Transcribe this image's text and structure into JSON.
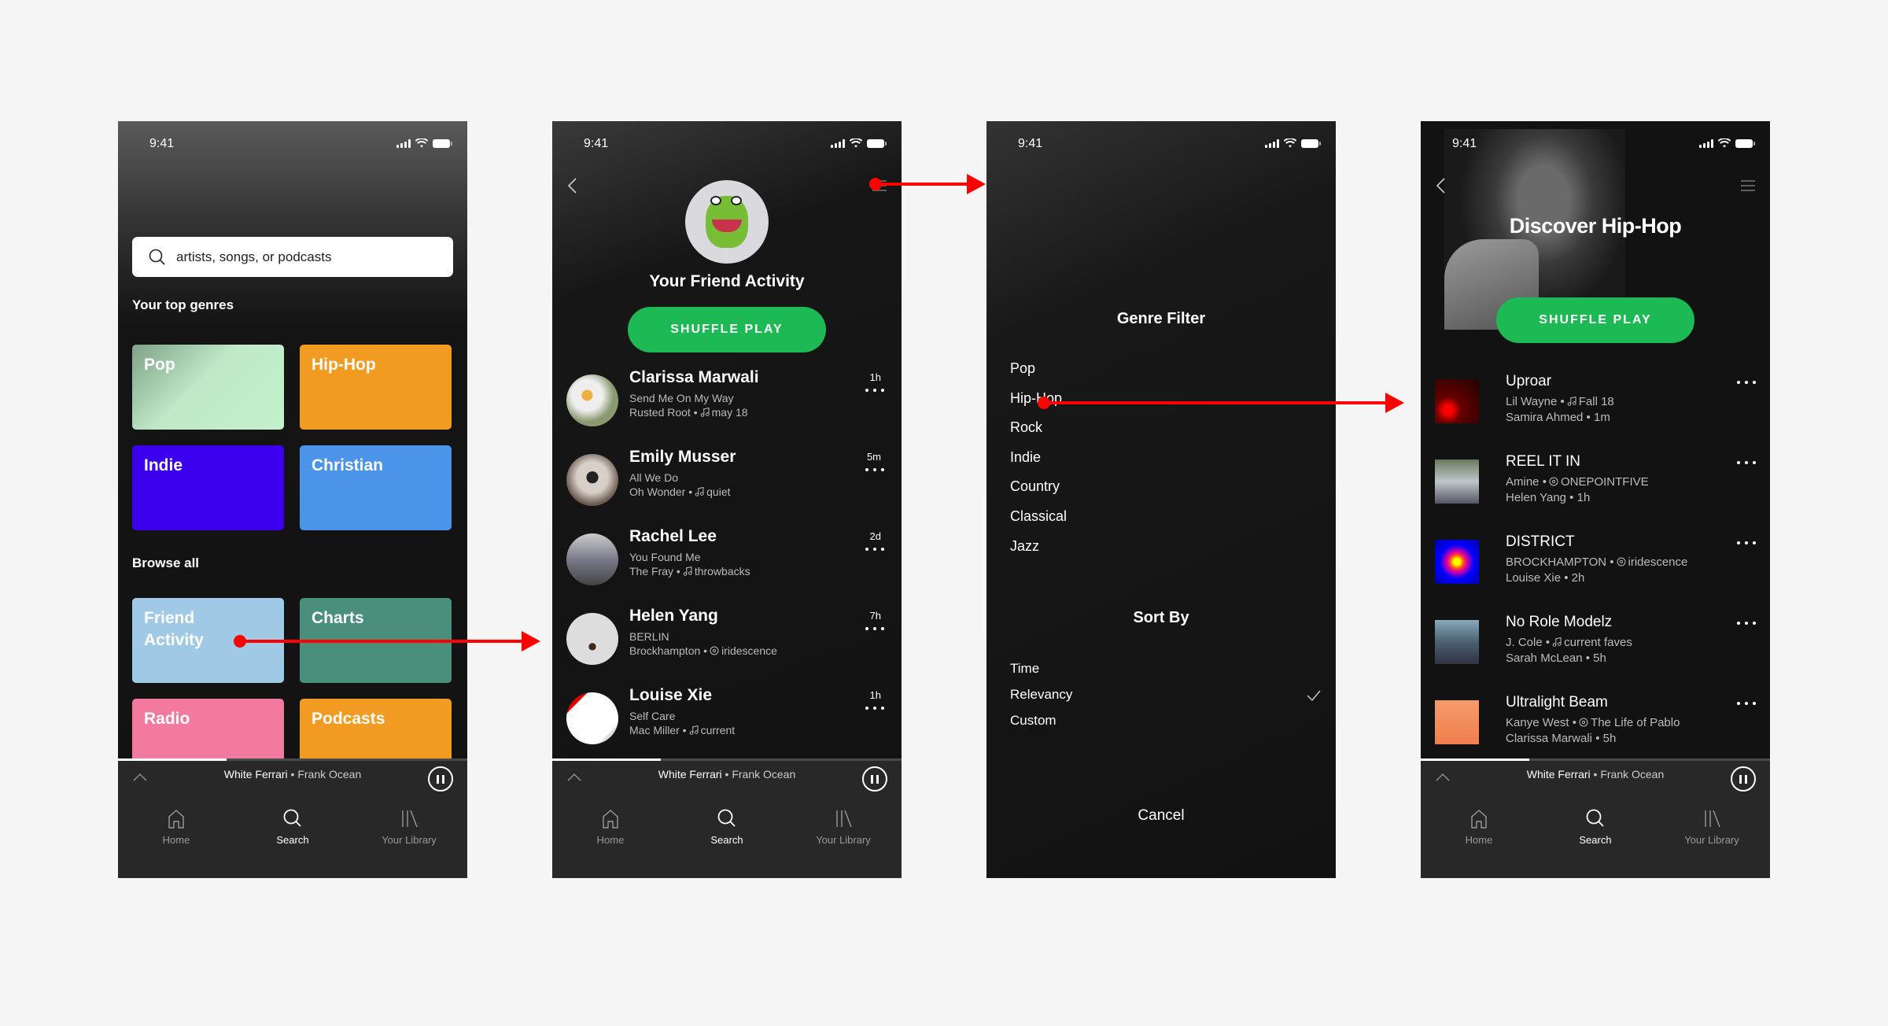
{
  "status": {
    "time": "9:41"
  },
  "search_screen": {
    "search_placeholder": "artists, songs, or podcasts",
    "top_genres_label": "Your top genres",
    "browse_all_label": "Browse all",
    "top_genres": [
      {
        "label": "Pop",
        "color": "#a6d8b0"
      },
      {
        "label": "Hip-Hop",
        "color": "#f29b22"
      },
      {
        "label": "Indie",
        "color": "#3b00ed"
      },
      {
        "label": "Christian",
        "color": "#4c94ea"
      }
    ],
    "browse_tiles": [
      {
        "label": "Friend Activity",
        "color": "#a0c9e6"
      },
      {
        "label": "Charts",
        "color": "#4a8f7b"
      },
      {
        "label": "Radio",
        "color": "#f27aa1"
      },
      {
        "label": "Podcasts",
        "color": "#f29b22"
      }
    ]
  },
  "player": {
    "song": "White Ferrari",
    "separator": " • ",
    "artist": "Frank Ocean",
    "progress": 0.31
  },
  "nav": [
    {
      "label": "Home",
      "icon": "home-icon",
      "active": false
    },
    {
      "label": "Search",
      "icon": "search-icon",
      "active": true
    },
    {
      "label": "Your Library",
      "icon": "library-icon",
      "active": false
    }
  ],
  "friends_screen": {
    "title": "Your Friend Activity",
    "shuffle_label": "SHUFFLE PLAY",
    "friends": [
      {
        "name": "Clarissa Marwali",
        "track": "Send Me On My Way",
        "artist": "Rusted Root",
        "source_type": "playlist",
        "source": "may 18",
        "time": "1h"
      },
      {
        "name": "Emily Musser",
        "track": "All We Do",
        "artist": "Oh Wonder",
        "source_type": "playlist",
        "source": "quiet",
        "time": "5m"
      },
      {
        "name": "Rachel Lee",
        "track": "You Found Me",
        "artist": "The Fray",
        "source_type": "playlist",
        "source": "throwbacks",
        "time": "2d"
      },
      {
        "name": "Helen Yang",
        "track": "BERLIN",
        "artist": "Brockhampton",
        "source_type": "album",
        "source": "iridescence",
        "time": "7h"
      },
      {
        "name": "Louise Xie",
        "track": "Self Care",
        "artist": "Mac Miller",
        "source_type": "playlist",
        "source": "current",
        "time": "1h"
      }
    ]
  },
  "filter_screen": {
    "genre_title": "Genre Filter",
    "genres": [
      "Pop",
      "Hip-Hop",
      "Rock",
      "Indie",
      "Country",
      "Classical",
      "Jazz"
    ],
    "sort_title": "Sort By",
    "sort_options": [
      {
        "label": "Time",
        "selected": false
      },
      {
        "label": "Relevancy",
        "selected": true
      },
      {
        "label": "Custom",
        "selected": false
      }
    ],
    "cancel_label": "Cancel"
  },
  "discover_screen": {
    "title": "Discover Hip-Hop",
    "shuffle_label": "SHUFFLE PLAY",
    "tracks": [
      {
        "title": "Uproar",
        "artist": "Lil Wayne",
        "source_type": "playlist",
        "source": "Fall 18",
        "friend": "Samira Ahmed",
        "time": "1m"
      },
      {
        "title": "REEL IT IN",
        "artist": "Amine",
        "source_type": "album",
        "source": "ONEPOINTFIVE",
        "friend": "Helen Yang",
        "time": "1h"
      },
      {
        "title": "DISTRICT",
        "artist": "BROCKHAMPTON",
        "source_type": "album",
        "source": "iridescence",
        "friend": "Louise Xie",
        "time": "2h"
      },
      {
        "title": "No Role Modelz",
        "artist": "J. Cole",
        "source_type": "playlist",
        "source": "current faves",
        "friend": "Sarah McLean",
        "time": "5h"
      },
      {
        "title": "Ultralight Beam",
        "artist": "Kanye West",
        "source_type": "album",
        "source": "The Life of Pablo",
        "friend": "Clarissa Marwali",
        "time": "5h"
      }
    ]
  },
  "colors": {
    "accent": "#1db954",
    "annotation": "#ff0000"
  }
}
